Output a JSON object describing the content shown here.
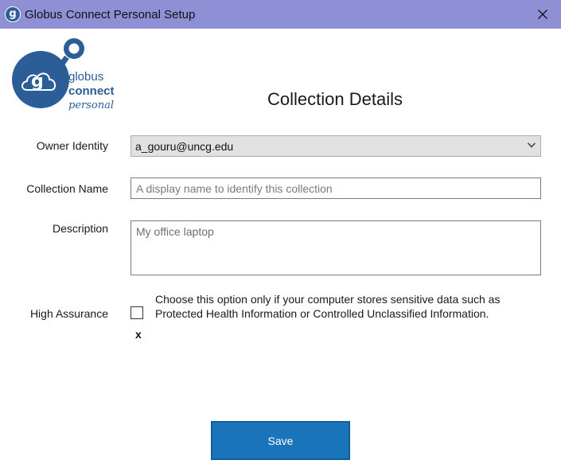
{
  "window": {
    "title": "Globus Connect Personal Setup",
    "icon_glyph": "g"
  },
  "logo": {
    "line1": "globus",
    "line2": "connect",
    "line3": "personal"
  },
  "heading": "Collection Details",
  "form": {
    "owner_identity": {
      "label": "Owner Identity",
      "value": "a_gouru@uncg.edu"
    },
    "collection_name": {
      "label": "Collection Name",
      "placeholder": "A display name to identify this collection",
      "value": ""
    },
    "description": {
      "label": "Description",
      "placeholder": "My office laptop",
      "value": ""
    },
    "high_assurance": {
      "label": "High Assurance",
      "checked": false,
      "mark": "x",
      "description": "Choose this option only if your computer stores sensitive data such as Protected Health Information or Controlled Unclassified Information."
    }
  },
  "save_button": {
    "label": "Save"
  },
  "colors": {
    "titlebar": "#8f8fd6",
    "brand_blue": "#2b5d96",
    "save_button": "#1a74b9"
  }
}
